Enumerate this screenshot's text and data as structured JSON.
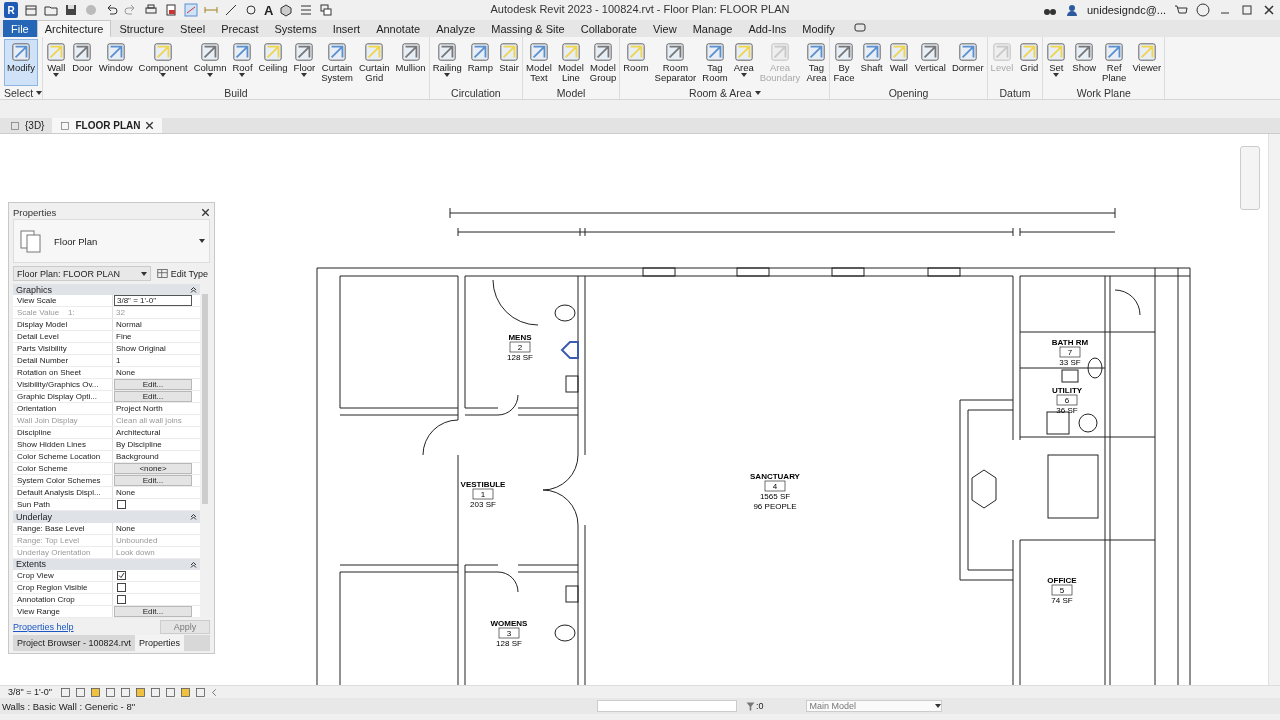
{
  "app_icon": "R",
  "quick_access_text": "A",
  "title": "Autodesk Revit 2023 - 100824.rvt - Floor Plan: FLOOR PLAN",
  "user": "unidesigndc@...",
  "menu_tabs": [
    {
      "label": "File",
      "kind": "file",
      "selected": false
    },
    {
      "label": "Architecture",
      "kind": "tab",
      "selected": true
    },
    {
      "label": "Structure",
      "kind": "tab",
      "selected": false
    },
    {
      "label": "Steel",
      "kind": "tab",
      "selected": false
    },
    {
      "label": "Precast",
      "kind": "tab",
      "selected": false
    },
    {
      "label": "Systems",
      "kind": "tab",
      "selected": false
    },
    {
      "label": "Insert",
      "kind": "tab",
      "selected": false
    },
    {
      "label": "Annotate",
      "kind": "tab",
      "selected": false
    },
    {
      "label": "Analyze",
      "kind": "tab",
      "selected": false
    },
    {
      "label": "Massing & Site",
      "kind": "tab",
      "selected": false
    },
    {
      "label": "Collaborate",
      "kind": "tab",
      "selected": false
    },
    {
      "label": "View",
      "kind": "tab",
      "selected": false
    },
    {
      "label": "Manage",
      "kind": "tab",
      "selected": false
    },
    {
      "label": "Add-Ins",
      "kind": "tab",
      "selected": false
    },
    {
      "label": "Modify",
      "kind": "tab",
      "selected": false
    }
  ],
  "ribbon_groups": [
    {
      "label": "Select",
      "dropdown": true,
      "tools": [
        {
          "label": "Modify",
          "selected": true,
          "disabled": false,
          "dropdown": false
        }
      ]
    },
    {
      "label": "Build",
      "dropdown": false,
      "tools": [
        {
          "label": "Wall",
          "selected": false,
          "disabled": false,
          "dropdown": true
        },
        {
          "label": "Door",
          "selected": false,
          "disabled": false,
          "dropdown": false
        },
        {
          "label": "Window",
          "selected": false,
          "disabled": false,
          "dropdown": false
        },
        {
          "label": "Component",
          "selected": false,
          "disabled": false,
          "dropdown": true
        },
        {
          "label": "Column",
          "selected": false,
          "disabled": false,
          "dropdown": true
        },
        {
          "label": "Roof",
          "selected": false,
          "disabled": false,
          "dropdown": true
        },
        {
          "label": "Ceiling",
          "selected": false,
          "disabled": false,
          "dropdown": false
        },
        {
          "label": "Floor",
          "selected": false,
          "disabled": false,
          "dropdown": true
        },
        {
          "label": "Curtain\nSystem",
          "selected": false,
          "disabled": false,
          "dropdown": false
        },
        {
          "label": "Curtain\nGrid",
          "selected": false,
          "disabled": false,
          "dropdown": false
        },
        {
          "label": "Mullion",
          "selected": false,
          "disabled": false,
          "dropdown": false
        }
      ]
    },
    {
      "label": "Circulation",
      "dropdown": false,
      "tools": [
        {
          "label": "Railing",
          "selected": false,
          "disabled": false,
          "dropdown": true
        },
        {
          "label": "Ramp",
          "selected": false,
          "disabled": false,
          "dropdown": false
        },
        {
          "label": "Stair",
          "selected": false,
          "disabled": false,
          "dropdown": false
        }
      ]
    },
    {
      "label": "Model",
      "dropdown": false,
      "tools": [
        {
          "label": "Model\nText",
          "selected": false,
          "disabled": false,
          "dropdown": false
        },
        {
          "label": "Model\nLine",
          "selected": false,
          "disabled": false,
          "dropdown": false
        },
        {
          "label": "Model\nGroup",
          "selected": false,
          "disabled": false,
          "dropdown": false
        }
      ]
    },
    {
      "label": "Room & Area",
      "dropdown": true,
      "tools": [
        {
          "label": "Room",
          "selected": false,
          "disabled": false,
          "dropdown": false
        },
        {
          "label": "Room\nSeparator",
          "selected": false,
          "disabled": false,
          "dropdown": false
        },
        {
          "label": "Tag\nRoom",
          "selected": false,
          "disabled": false,
          "dropdown": false
        },
        {
          "label": "Area",
          "selected": false,
          "disabled": false,
          "dropdown": true
        },
        {
          "label": "Area\nBoundary",
          "selected": false,
          "disabled": true,
          "dropdown": false
        },
        {
          "label": "Tag\nArea",
          "selected": false,
          "disabled": false,
          "dropdown": false
        }
      ]
    },
    {
      "label": "Opening",
      "dropdown": false,
      "tools": [
        {
          "label": "By\nFace",
          "selected": false,
          "disabled": false,
          "dropdown": false
        },
        {
          "label": "Shaft",
          "selected": false,
          "disabled": false,
          "dropdown": false
        },
        {
          "label": "Wall",
          "selected": false,
          "disabled": false,
          "dropdown": false
        },
        {
          "label": "Vertical",
          "selected": false,
          "disabled": false,
          "dropdown": false
        },
        {
          "label": "Dormer",
          "selected": false,
          "disabled": false,
          "dropdown": false
        }
      ]
    },
    {
      "label": "Datum",
      "dropdown": false,
      "tools": [
        {
          "label": "Level",
          "selected": false,
          "disabled": true,
          "dropdown": false
        },
        {
          "label": "Grid",
          "selected": false,
          "disabled": false,
          "dropdown": false
        }
      ]
    },
    {
      "label": "Work Plane",
      "dropdown": false,
      "tools": [
        {
          "label": "Set",
          "selected": false,
          "disabled": false,
          "dropdown": true
        },
        {
          "label": "Show",
          "selected": false,
          "disabled": false,
          "dropdown": false
        },
        {
          "label": "Ref\nPlane",
          "selected": false,
          "disabled": false,
          "dropdown": false
        },
        {
          "label": "Viewer",
          "selected": false,
          "disabled": false,
          "dropdown": false
        }
      ]
    }
  ],
  "view_tabs": [
    {
      "label": "{3D}",
      "selected": false,
      "closable": false
    },
    {
      "label": "FLOOR PLAN",
      "selected": true,
      "closable": true
    }
  ],
  "rooms": [
    {
      "name": "MENS",
      "number": "2",
      "area": "128 SF"
    },
    {
      "name": "VESTIBULE",
      "number": "1",
      "area": "203 SF"
    },
    {
      "name": "SANCTUARY",
      "number": "4",
      "area": "1565 SF",
      "occupancy": "96 PEOPLE"
    },
    {
      "name": "BATH RM",
      "number": "7",
      "area": "33 SF"
    },
    {
      "name": "UTILITY",
      "number": "6",
      "area": "36 SF"
    },
    {
      "name": "OFFICE",
      "number": "5",
      "area": "74 SF"
    },
    {
      "name": "WOMENS",
      "number": "3",
      "area": "128 SF"
    }
  ],
  "properties": {
    "title": "Properties",
    "type_name": "Floor Plan",
    "instance": "Floor Plan: FLOOR PLAN",
    "edit_type": "Edit Type",
    "sections": [
      {
        "name": "Graphics",
        "expanded": true,
        "rows": [
          {
            "label": "View Scale",
            "value": "3/8\" = 1'-0\"",
            "kind": "input",
            "disabled": false
          },
          {
            "label": "Scale Value    1:",
            "value": "32",
            "kind": "text",
            "disabled": true
          },
          {
            "label": "Display Model",
            "value": "Normal",
            "kind": "text",
            "disabled": false
          },
          {
            "label": "Detail Level",
            "value": "Fine",
            "kind": "text",
            "disabled": false
          },
          {
            "label": "Parts Visibility",
            "value": "Show Original",
            "kind": "text",
            "disabled": false
          },
          {
            "label": "Detail Number",
            "value": "1",
            "kind": "text",
            "disabled": false
          },
          {
            "label": "Rotation on Sheet",
            "value": "None",
            "kind": "text",
            "disabled": false
          },
          {
            "label": "Visibility/Graphics Ov...",
            "value": "Edit...",
            "kind": "button",
            "disabled": false
          },
          {
            "label": "Graphic Display Opti...",
            "value": "Edit...",
            "kind": "button",
            "disabled": false
          },
          {
            "label": "Orientation",
            "value": "Project North",
            "kind": "text",
            "disabled": false
          },
          {
            "label": "Wall Join Display",
            "value": "Clean all wall joins",
            "kind": "text",
            "disabled": true
          },
          {
            "label": "Discipline",
            "value": "Architectural",
            "kind": "text",
            "disabled": false
          },
          {
            "label": "Show Hidden Lines",
            "value": "By Discipline",
            "kind": "text",
            "disabled": false
          },
          {
            "label": "Color Scheme Location",
            "value": "Background",
            "kind": "text",
            "disabled": false
          },
          {
            "label": "Color Scheme",
            "value": "<none>",
            "kind": "button",
            "disabled": false
          },
          {
            "label": "System Color Schemes",
            "value": "Edit...",
            "kind": "button",
            "disabled": false
          },
          {
            "label": "Default Analysis Displ...",
            "value": "None",
            "kind": "text",
            "disabled": false
          },
          {
            "label": "Sun Path",
            "kind": "checkbox",
            "checked": false,
            "disabled": false
          }
        ]
      },
      {
        "name": "Underlay",
        "expanded": true,
        "rows": [
          {
            "label": "Range: Base Level",
            "value": "None",
            "kind": "text",
            "disabled": false
          },
          {
            "label": "Range: Top Level",
            "value": "Unbounded",
            "kind": "text",
            "disabled": true
          },
          {
            "label": "Underlay Orientation",
            "value": "Look down",
            "kind": "text",
            "disabled": true
          }
        ]
      },
      {
        "name": "Extents",
        "expanded": true,
        "rows": [
          {
            "label": "Crop View",
            "kind": "checkbox",
            "checked": true,
            "disabled": false
          },
          {
            "label": "Crop Region Visible",
            "kind": "checkbox",
            "checked": false,
            "disabled": false
          },
          {
            "label": "Annotation Crop",
            "kind": "checkbox",
            "checked": false,
            "disabled": false
          },
          {
            "label": "View Range",
            "value": "Edit...",
            "kind": "button",
            "disabled": false
          }
        ]
      }
    ],
    "help_link": "Properties help",
    "apply": {
      "label": "Apply",
      "disabled": true
    },
    "tabs": [
      {
        "label": "Project Browser - 100824.rvt",
        "selected": false
      },
      {
        "label": "Properties",
        "selected": true
      }
    ]
  },
  "view_scale": "3/8\" = 1'-0\"",
  "status": {
    "message": "Walls : Basic Wall : Generic - 8\"",
    "selection_count": ":0",
    "model": "Main Model"
  }
}
